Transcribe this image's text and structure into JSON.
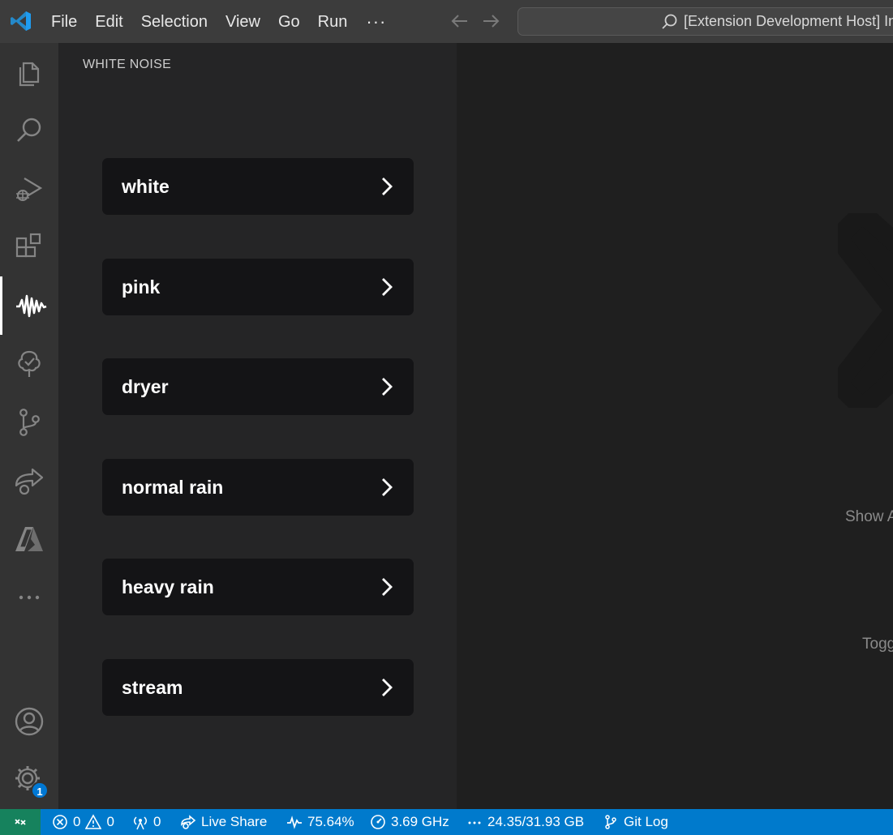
{
  "titlebar": {
    "menu": [
      "File",
      "Edit",
      "Selection",
      "View",
      "Go",
      "Run"
    ],
    "more": "···",
    "command_center": "[Extension Development Host] Im"
  },
  "activitybar": {
    "items": [
      "explorer-icon",
      "search-icon",
      "run-debug-icon",
      "extensions-icon",
      "white-noise-icon",
      "tree-icon",
      "source-control-icon",
      "live-share-icon",
      "azure-icon",
      "more-icon"
    ],
    "active": "white-noise-icon",
    "settings_badge": "1"
  },
  "sidebar": {
    "title": "WHITE NOISE",
    "buttons": [
      "white",
      "pink",
      "dryer",
      "normal rain",
      "heavy rain",
      "stream"
    ]
  },
  "editor": {
    "hint_1": "Show A",
    "hint_2": "Togg"
  },
  "statusbar": {
    "errors": "0",
    "warnings": "0",
    "ports": "0",
    "live_share": "Live Share",
    "cpu": "75.64%",
    "freq": "3.69 GHz",
    "memory": "24.35/31.93 GB",
    "git_log": "Git Log"
  },
  "colors": {
    "accent": "#007acc",
    "remote": "#16825d",
    "button_bg": "#141416"
  }
}
